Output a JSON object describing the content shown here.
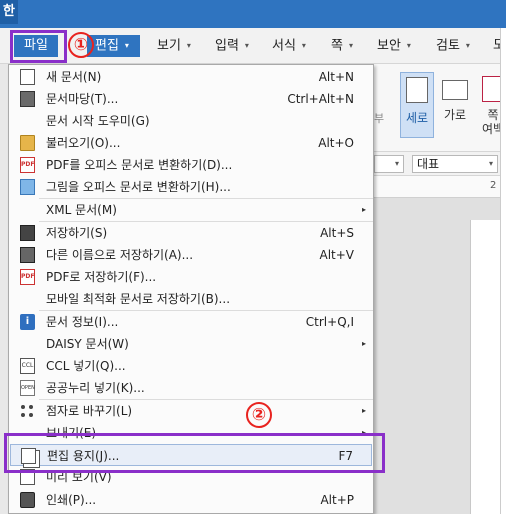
{
  "app": {
    "logo": "한"
  },
  "menubar": {
    "items": [
      {
        "label": "파일"
      },
      {
        "label": "편집"
      },
      {
        "label": "보기"
      },
      {
        "label": "입력"
      },
      {
        "label": "서식"
      },
      {
        "label": "쪽"
      },
      {
        "label": "보안"
      },
      {
        "label": "검토"
      },
      {
        "label": "도"
      }
    ],
    "arrow": "▾"
  },
  "annotations": {
    "step1": "①",
    "step2": "②"
  },
  "ribbon": {
    "portrait": "세로",
    "landscape": "가로",
    "margin_top": "쪽",
    "margin_bottom": "여백",
    "side_mark": "부"
  },
  "formatbar": {
    "combo_a": "",
    "style": "대표"
  },
  "ruler": {
    "mark": "2"
  },
  "file_menu": {
    "items": [
      {
        "label": "새 문서(N)",
        "shortcut": "Alt+N",
        "icon": "new-document-icon"
      },
      {
        "label": "문서마당(T)...",
        "shortcut": "Ctrl+Alt+N",
        "icon": "template-icon"
      },
      {
        "label": "문서 시작 도우미(G)",
        "shortcut": "",
        "icon": ""
      },
      {
        "label": "불러오기(O)...",
        "shortcut": "Alt+O",
        "icon": "open-folder-icon"
      },
      {
        "label": "PDF를 오피스 문서로 변환하기(D)...",
        "shortcut": "",
        "icon": "pdf-icon"
      },
      {
        "label": "그림을 오피스 문서로 변환하기(H)...",
        "shortcut": "",
        "icon": "image-convert-icon"
      },
      {
        "label": "XML 문서(M)",
        "shortcut": "",
        "icon": "",
        "submenu": true
      },
      {
        "label": "저장하기(S)",
        "shortcut": "Alt+S",
        "icon": "save-icon"
      },
      {
        "label": "다른 이름으로 저장하기(A)...",
        "shortcut": "Alt+V",
        "icon": "save-as-icon"
      },
      {
        "label": "PDF로 저장하기(F)...",
        "shortcut": "",
        "icon": "pdf-icon"
      },
      {
        "label": "모바일 최적화 문서로 저장하기(B)...",
        "shortcut": "",
        "icon": ""
      },
      {
        "label": "문서 정보(I)...",
        "shortcut": "Ctrl+Q,I",
        "icon": "info-icon"
      },
      {
        "label": "DAISY 문서(W)",
        "shortcut": "",
        "icon": "",
        "submenu": true
      },
      {
        "label": "CCL 넣기(Q)...",
        "shortcut": "",
        "icon": "ccl-icon"
      },
      {
        "label": "공공누리 넣기(K)...",
        "shortcut": "",
        "icon": "open-license-icon"
      },
      {
        "label": "점자로 바꾸기(L)",
        "shortcut": "",
        "icon": "braille-icon",
        "submenu": true
      },
      {
        "label": "보내기(E)",
        "shortcut": "",
        "icon": "",
        "submenu": true
      },
      {
        "label": "편집 용지(J)...",
        "shortcut": "F7",
        "icon": "page-setup-icon",
        "selected": true
      },
      {
        "label": "미리 보기(V)",
        "shortcut": "",
        "icon": "preview-icon"
      },
      {
        "label": "인쇄(P)...",
        "shortcut": "Alt+P",
        "icon": "print-icon"
      }
    ],
    "submenu_arrow": "▸",
    "icon_text": {
      "pdf": "PDF",
      "info": "i",
      "ccl": "CCL",
      "open": "OPEN"
    }
  },
  "colors": {
    "accent": "#2f74c0",
    "highlight": "#8a2fc9",
    "annotation": "#e8231f"
  }
}
